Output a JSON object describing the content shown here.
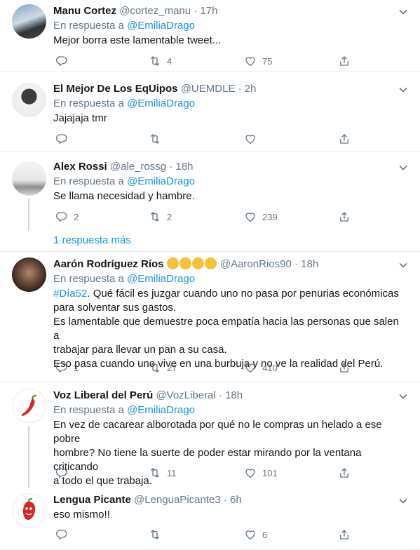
{
  "tweets": [
    {
      "name": "Manu Cortez",
      "handle": "@cortez_manu",
      "time": "17h",
      "reply_prefix": "En respuesta a ",
      "reply_mention": "@EmiliaDrago",
      "text": "Mejor borra este lamentable tweet...",
      "reply_count": "",
      "retweet_count": "4",
      "like_count": "75"
    },
    {
      "name": "El Mejor De Los EqUipos",
      "handle": "@UEMDLE",
      "time": "2h",
      "reply_prefix": "En respuesta a ",
      "reply_mention": "@EmiliaDrago",
      "text": "Jajajaja tmr",
      "reply_count": "",
      "retweet_count": "",
      "like_count": ""
    },
    {
      "name": "Alex Rossi",
      "handle": "@ale_rossg",
      "time": "18h",
      "reply_prefix": "En respuesta a ",
      "reply_mention": "@EmiliaDrago",
      "text": "Se llama necesidad y hambre.",
      "reply_count": "2",
      "retweet_count": "2",
      "like_count": "239",
      "more_replies": "1 respuesta más"
    },
    {
      "name": "Aarón Rodríguez Ríos",
      "handle": "@AaronRios90",
      "time": "18h",
      "reply_prefix": "En respuesta a ",
      "reply_mention": "@EmiliaDrago",
      "hashtag": "#Día52",
      "text_line1": ". Qué fácil es juzgar cuando uno no pasa por penurias económicas",
      "text_line2": "para solventar sus gastos.",
      "text_line3": "Es lamentable que demuestre poca empatía hacia las personas que salen a",
      "text_line4": "trabajar para llevar un pan a su casa.",
      "text_line5": "Eso pasa cuando uno vive en una burbuja y no ve la realidad del Perú.",
      "reply_count": "1",
      "retweet_count": "27",
      "like_count": "410"
    },
    {
      "name": "Voz Liberal del Perú",
      "handle": "@VozLiberal",
      "time": "18h",
      "reply_prefix": "En respuesta a ",
      "reply_mention": "@EmiliaDrago",
      "text_line1": "En vez de cacarear alborotada por qué no le compras un helado a ese pobre",
      "text_line2": "hombre? No tiene la suerte de poder estar mirando por la ventana criticando",
      "text_line3": "a todo el que trabaja.",
      "reply_count": "",
      "retweet_count": "11",
      "like_count": "101"
    },
    {
      "name": "Lengua Picante",
      "handle": "@LenguaPicante3",
      "time": "6h",
      "text": "eso mismo!!",
      "reply_count": "",
      "retweet_count": "",
      "like_count": "6"
    }
  ],
  "separator": "·",
  "icons": {
    "reply": "reply-icon",
    "retweet": "retweet-icon",
    "like": "heart-icon",
    "share": "share-icon",
    "caret": "chevron-down-icon"
  },
  "colors": {
    "link": "#1b95e0",
    "secondary_text": "#657786",
    "divider": "#e6ecf0",
    "thread_line": "#ccd6dd"
  }
}
